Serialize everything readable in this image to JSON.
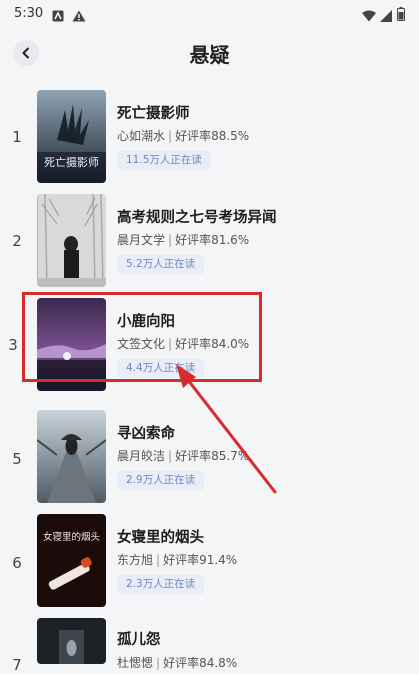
{
  "status_bar": {
    "time": "5:30"
  },
  "header": {
    "title": "悬疑"
  },
  "books": [
    {
      "rank": "1",
      "title": "死亡摄影师",
      "author": "心如潮水",
      "rating": "好评率88.5%",
      "reading": "11.5万人正在读",
      "cover_text": "死亡摄影师"
    },
    {
      "rank": "2",
      "title": "高考规则之七号考场异闻",
      "author": "晨月文学",
      "rating": "好评率81.6%",
      "reading": "5.2万人正在读"
    },
    {
      "rank": "3",
      "title": "小鹿向阳",
      "author": "文签文化",
      "rating": "好评率84.0%",
      "reading": "4.4万人正在读"
    },
    {
      "rank": "5",
      "title": "寻凶索命",
      "author": "晨月皎洁",
      "rating": "好评率85.7%",
      "reading": "2.9万人正在读"
    },
    {
      "rank": "6",
      "title": "女寝里的烟头",
      "author": "东方旭",
      "rating": "好评率91.4%",
      "reading": "2.3万人正在读",
      "cover_text": "女寝里的烟头"
    },
    {
      "rank": "7",
      "title": "孤儿怨",
      "author": "杜愢愢",
      "rating": "好评率84.8%"
    }
  ],
  "separator": "|",
  "annotation": {
    "color": "#d72c2c"
  }
}
